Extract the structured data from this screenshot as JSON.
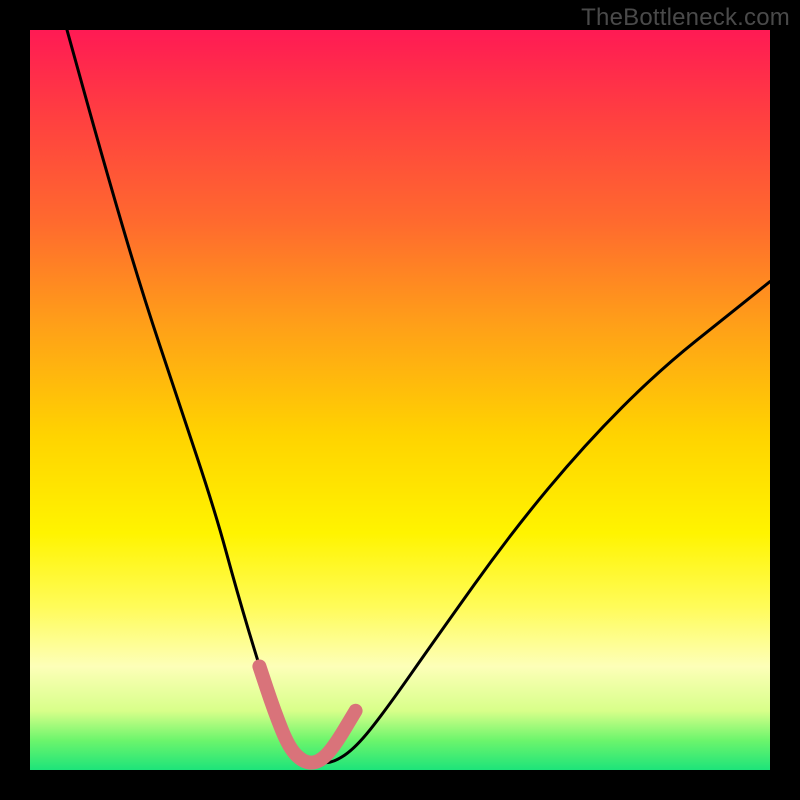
{
  "watermark": "TheBottleneck.com",
  "chart_data": {
    "type": "line",
    "title": "",
    "xlabel": "",
    "ylabel": "",
    "xlim": [
      0,
      100
    ],
    "ylim": [
      0,
      100
    ],
    "series": [
      {
        "name": "bottleneck-curve",
        "x": [
          5,
          10,
          15,
          20,
          25,
          28,
          31,
          33,
          35,
          37,
          39,
          41,
          44,
          48,
          55,
          65,
          75,
          85,
          95,
          100
        ],
        "y": [
          100,
          82,
          65,
          50,
          35,
          24,
          14,
          8,
          3,
          1,
          1,
          1,
          3,
          8,
          18,
          32,
          44,
          54,
          62,
          66
        ]
      }
    ],
    "highlight_segment": {
      "name": "valley-highlight",
      "x": [
        31,
        33,
        35,
        37,
        39,
        41,
        44
      ],
      "y": [
        14,
        8,
        3,
        1,
        1,
        3,
        8
      ]
    },
    "background_gradient": {
      "top": "#ff1a54",
      "mid": "#ffd400",
      "bottom": "#1de47a"
    }
  }
}
